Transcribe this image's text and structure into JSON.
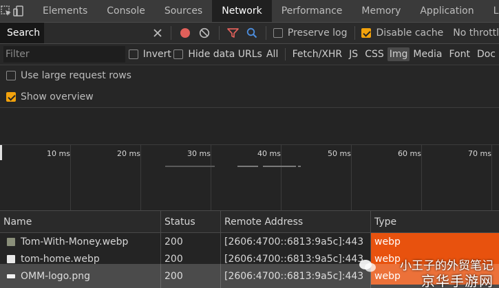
{
  "tabs": [
    {
      "label": "Elements",
      "active": false
    },
    {
      "label": "Console",
      "active": false
    },
    {
      "label": "Sources",
      "active": false
    },
    {
      "label": "Network",
      "active": true
    },
    {
      "label": "Performance",
      "active": false
    },
    {
      "label": "Memory",
      "active": false
    },
    {
      "label": "Application",
      "active": false
    },
    {
      "label": "Ligh",
      "active": false
    }
  ],
  "toolbar": {
    "search_label": "Search",
    "preserve_log": {
      "label": "Preserve log",
      "checked": false
    },
    "disable_cache": {
      "label": "Disable cache",
      "checked": true
    },
    "throttle_label": "No throttl"
  },
  "filter": {
    "placeholder": "Filter",
    "invert": {
      "label": "Invert",
      "checked": false
    },
    "hide_data_urls": {
      "label": "Hide data URLs",
      "checked": false
    },
    "types": [
      "All",
      "Fetch/XHR",
      "JS",
      "CSS",
      "Img",
      "Media",
      "Font",
      "Doc"
    ],
    "selected_type": "Img"
  },
  "options": {
    "large_rows": {
      "label": "Use large request rows",
      "checked": false
    },
    "show_overview": {
      "label": "Show overview",
      "checked": true
    }
  },
  "timeline": {
    "labels": [
      "10 ms",
      "20 ms",
      "30 ms",
      "40 ms",
      "50 ms",
      "60 ms",
      "70 ms"
    ]
  },
  "table": {
    "columns": [
      "Name",
      "Status",
      "Remote Address",
      "Type"
    ],
    "rows": [
      {
        "name": "Tom-With-Money.webp",
        "status": "200",
        "address": "[2606:4700::6813:9a5c]:443",
        "type": "webp"
      },
      {
        "name": "tom-home.webp",
        "status": "200",
        "address": "[2606:4700::6813:9a5c]:443",
        "type": "webp"
      },
      {
        "name": "OMM-logo.png",
        "status": "200",
        "address": "[2606:4700::6813:9a5c]:443",
        "type": "webp"
      }
    ]
  },
  "watermark": {
    "line1": "小王子的外贸笔记",
    "line2": "京华手游网"
  },
  "colors": {
    "accent": "#f2a20c",
    "record": "#e0605a",
    "type_highlight": "#e8520e",
    "search_icon": "#4d8fe0"
  }
}
